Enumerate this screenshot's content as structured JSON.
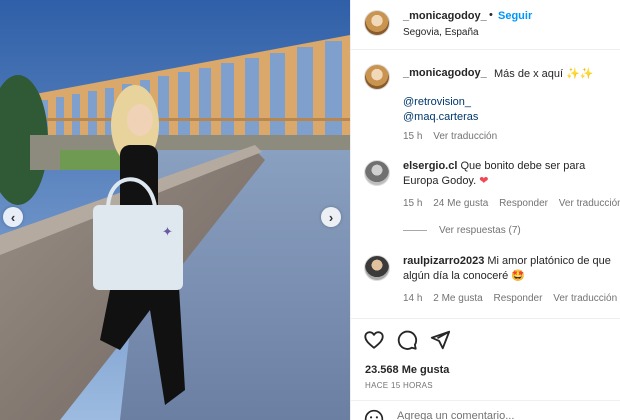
{
  "post": {
    "username": "_monicagodoy_",
    "follow_label": "Seguir",
    "separator": "•",
    "location": "Segovia, España"
  },
  "caption": {
    "username": "_monicagodoy_",
    "text": "Más de x aquí ✨✨",
    "mentions": [
      "@retrovision_",
      "@maq.carteras"
    ],
    "time": "15 h",
    "translate": "Ver traducción"
  },
  "comments": [
    {
      "username": "elsergio.cl",
      "text": "Que bonito debe ser para Europa Godoy.",
      "emoji": "❤",
      "time": "15 h",
      "likes": "24 Me gusta",
      "reply": "Responder",
      "translate": "Ver traducción",
      "view_replies": "Ver respuestas (7)"
    },
    {
      "username": "raulpizarro2023",
      "text": "Mi amor platónico de que algún día la conoceré",
      "emoji": "🤩",
      "time": "14 h",
      "likes": "2 Me gusta",
      "reply": "Responder",
      "translate": "Ver traducción"
    }
  ],
  "stats": {
    "likes": "23.568 Me gusta",
    "posted": "HACE 15 HORAS"
  },
  "add_comment": {
    "placeholder": "Agrega un comentario..."
  },
  "icons": {
    "like": "heart-outline-icon",
    "comment": "comment-bubble-icon",
    "share": "send-paper-plane-icon",
    "emoji": "smiley-icon",
    "prev": "chevron-left-icon",
    "next": "chevron-right-icon"
  },
  "colors": {
    "accent": "#0095f6",
    "mention": "#00376b",
    "secondary_text": "#737373",
    "heart": "#ed4956"
  }
}
